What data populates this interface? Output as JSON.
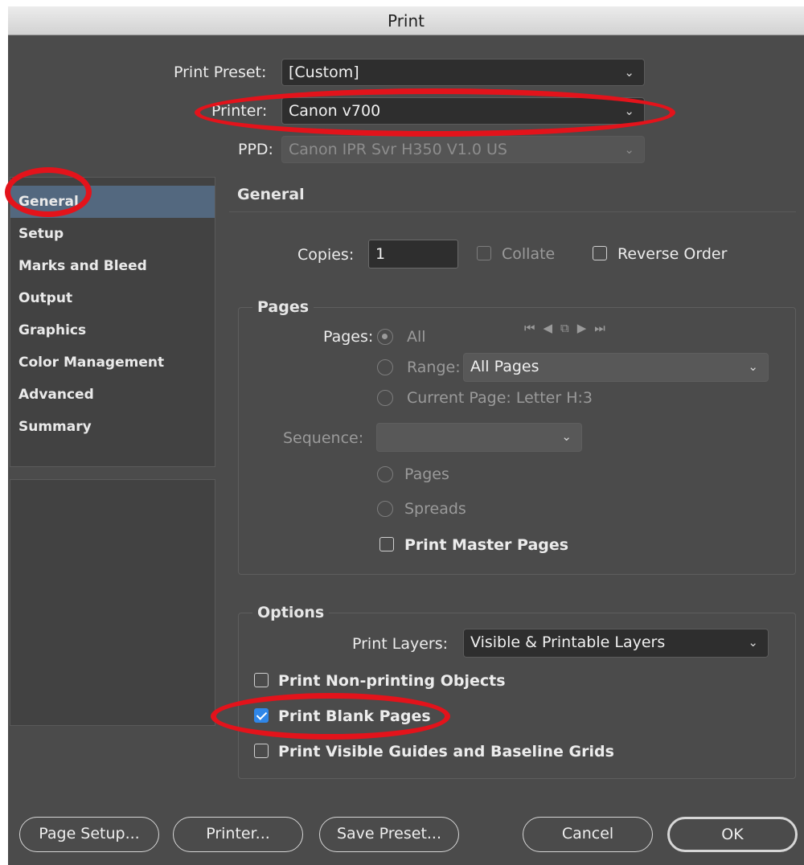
{
  "window": {
    "title": "Print"
  },
  "top": {
    "print_preset_label": "Print Preset:",
    "print_preset_value": "[Custom]",
    "printer_label": "Printer:",
    "printer_value": "Canon v700",
    "ppd_label": "PPD:",
    "ppd_value": "Canon IPR Svr H350 V1.0 US"
  },
  "sidebar": {
    "items": [
      {
        "label": "General"
      },
      {
        "label": "Setup"
      },
      {
        "label": "Marks and Bleed"
      },
      {
        "label": "Output"
      },
      {
        "label": "Graphics"
      },
      {
        "label": "Color Management"
      },
      {
        "label": "Advanced"
      },
      {
        "label": "Summary"
      }
    ],
    "selected": "General"
  },
  "general": {
    "heading": "General",
    "copies_label": "Copies:",
    "copies_value": "1",
    "collate_label": "Collate",
    "collate_checked": false,
    "reverse_order_label": "Reverse Order",
    "reverse_order_checked": false
  },
  "pages_group": {
    "title": "Pages",
    "pages_label": "Pages:",
    "all_label": "All",
    "range_label": "Range:",
    "range_value": "All Pages",
    "current_page_label": "Current Page: Letter H:3",
    "sequence_label": "Sequence:",
    "sequence_value": "",
    "pages_option": "Pages",
    "spreads_option": "Spreads",
    "print_master_pages_label": "Print Master Pages",
    "print_master_pages_checked": false
  },
  "options_group": {
    "title": "Options",
    "print_layers_label": "Print Layers:",
    "print_layers_value": "Visible & Printable Layers",
    "non_printing_label": "Print Non-printing Objects",
    "non_printing_checked": false,
    "blank_pages_label": "Print Blank Pages",
    "blank_pages_checked": true,
    "guides_label": "Print Visible Guides and Baseline Grids",
    "guides_checked": false
  },
  "buttons": {
    "page_setup": "Page Setup...",
    "printer": "Printer...",
    "save_preset": "Save Preset...",
    "cancel": "Cancel",
    "ok": "OK"
  },
  "icons": {
    "chevron": "chevron-down-icon",
    "page_nav": "page-navigation-icons"
  },
  "colors": {
    "window_bg": "#4b4b4b",
    "selection": "#53687f",
    "checkbox_accent": "#2f86e8",
    "annotation_red": "#e3131b"
  }
}
